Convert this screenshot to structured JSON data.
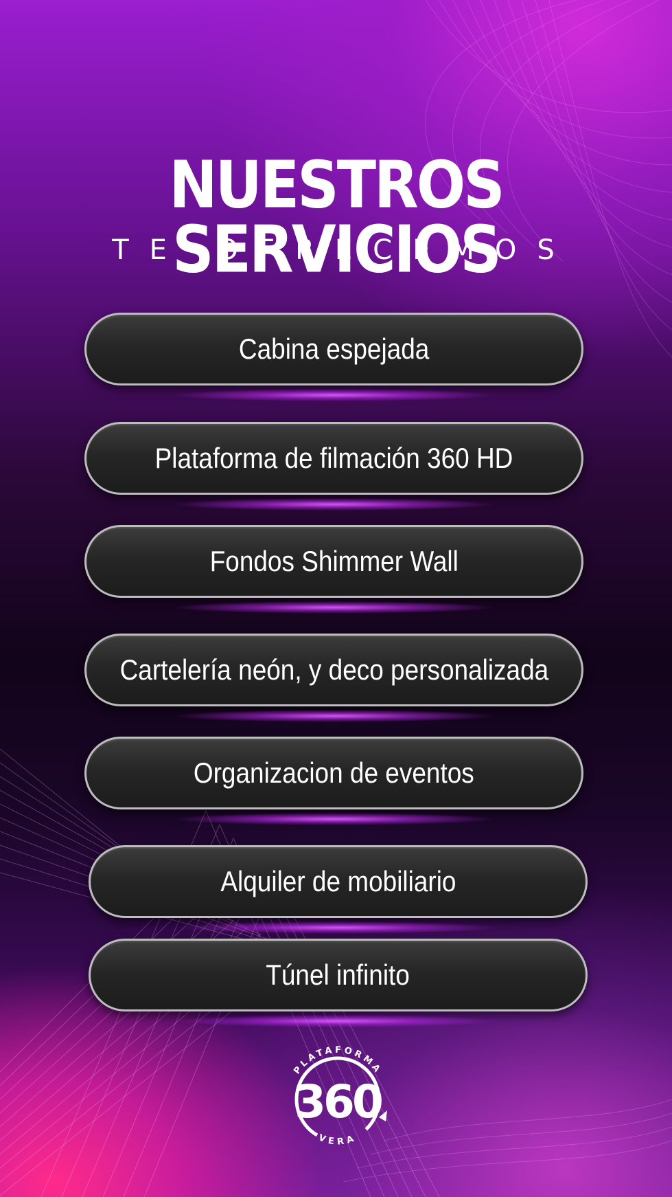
{
  "header": {
    "title": "NUESTROS SERVICIOS",
    "subtitle": "TE OFRECEMOS"
  },
  "services": [
    {
      "label": "Cabina espejada"
    },
    {
      "label": "Plataforma de filmación 360 HD"
    },
    {
      "label": "Fondos Shimmer Wall"
    },
    {
      "label": "Cartelería neón, y deco personalizada"
    },
    {
      "label": "Organizacion de eventos"
    },
    {
      "label": "Alquiler de mobiliario"
    },
    {
      "label": "Túnel infinito"
    }
  ],
  "logo": {
    "number": "360",
    "top_text": "PLATAFORMA",
    "bottom_text": "VERA"
  },
  "colors": {
    "background_top": "#9b1ed0",
    "background_mid": "#12041a",
    "glow": "#dc5aff",
    "pill_fill": "#262626",
    "pill_border": "#bdbdbd",
    "text": "#ffffff"
  }
}
